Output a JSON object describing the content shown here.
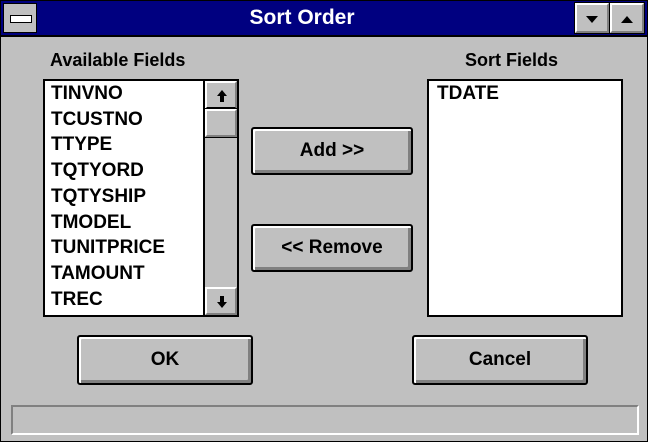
{
  "window": {
    "title": "Sort Order",
    "title_bar_color": "#000080",
    "background_color": "#c0c0c0"
  },
  "available_fields": {
    "label": "Available Fields",
    "items": [
      "TINVNO",
      "TCUSTNO",
      "TTYPE",
      "TQTYORD",
      "TQTYSHIP",
      "TMODEL",
      "TUNITPRICE",
      "TAMOUNT",
      "TREC"
    ]
  },
  "sort_fields": {
    "label": "Sort Fields",
    "items": [
      "TDATE"
    ]
  },
  "buttons": {
    "add": "Add >>",
    "remove": "<< Remove",
    "ok": "OK",
    "cancel": "Cancel"
  },
  "status": {
    "text": ""
  },
  "icons": {
    "system_menu": "system-menu-icon",
    "minimize": "triangle-down-icon",
    "maximize": "triangle-up-icon",
    "scroll_up": "arrow-up-icon",
    "scroll_down": "arrow-down-icon"
  }
}
